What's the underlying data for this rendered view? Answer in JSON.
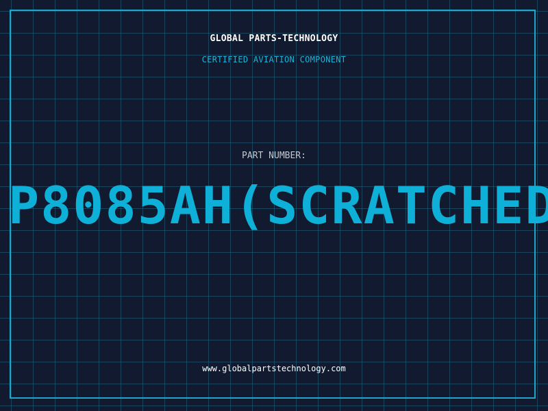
{
  "header": {
    "company": "GLOBAL PARTS-TECHNOLOGY",
    "subtitle": "CERTIFIED AVIATION COMPONENT"
  },
  "part": {
    "label": "PART NUMBER:",
    "number": "P8085AH(SCRATCHED"
  },
  "footer": {
    "website": "www.globalpartstechnology.com"
  },
  "colors": {
    "background": "#111a2e",
    "grid": "#237896",
    "accent": "#0fb0d8",
    "text": "#ffffff"
  }
}
